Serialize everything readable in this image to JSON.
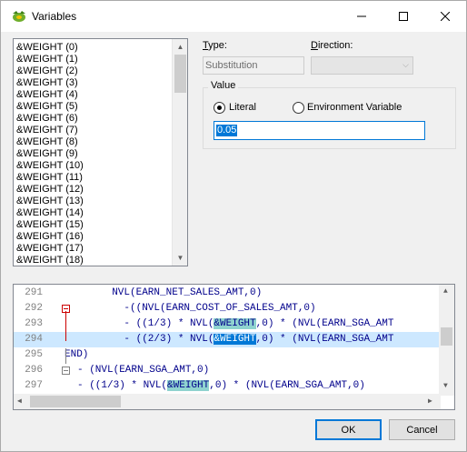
{
  "window": {
    "title": "Variables",
    "icon": "app-logo-icon"
  },
  "variable_list": {
    "items": [
      "&WEIGHT (0)",
      "&WEIGHT (1)",
      "&WEIGHT (2)",
      "&WEIGHT (3)",
      "&WEIGHT (4)",
      "&WEIGHT (5)",
      "&WEIGHT (6)",
      "&WEIGHT (7)",
      "&WEIGHT (8)",
      "&WEIGHT (9)",
      "&WEIGHT (10)",
      "&WEIGHT (11)",
      "&WEIGHT (12)",
      "&WEIGHT (13)",
      "&WEIGHT (14)",
      "&WEIGHT (15)",
      "&WEIGHT (16)",
      "&WEIGHT (17)",
      "&WEIGHT (18)"
    ]
  },
  "form": {
    "type_label": "Type:",
    "type_value": "Substitution",
    "direction_label": "Direction:",
    "direction_value": "",
    "value_group_label": "Value",
    "radio_literal": "Literal",
    "radio_env": "Environment Variable",
    "selected_radio": "Literal",
    "value": "0.05"
  },
  "editor": {
    "highlight_token": "&WEIGHT",
    "current_line": "294",
    "lines": [
      {
        "num": "291",
        "before": "  NVL(EARN_NET_SALES_AMT,0)",
        "token": "",
        "after": ""
      },
      {
        "num": "292",
        "before": "    -((NVL(EARN_COST_OF_SALES_AMT,0)",
        "token": "",
        "after": ""
      },
      {
        "num": "293",
        "before": "    - ((1/3) * NVL(",
        "token": "&WEIGHT",
        "after": ",0) * (NVL(EARN_SGA_AMT"
      },
      {
        "num": "294",
        "before": "    - ((2/3) * NVL(",
        "token": "&WEIGHT",
        "after": ",0) * (NVL(EARN_SGA_AMT"
      },
      {
        "num": "295",
        "before": "END)",
        "token": "",
        "after": ""
      },
      {
        "num": "296",
        "before": "- (NVL(EARN_SGA_AMT,0)",
        "token": "",
        "after": ""
      },
      {
        "num": "297",
        "before": "- ((1/3) * NVL(",
        "token": "&WEIGHT",
        "after": ",0) * (NVL(EARN_SGA_AMT,0)"
      }
    ]
  },
  "buttons": {
    "ok": "OK",
    "cancel": "Cancel"
  }
}
